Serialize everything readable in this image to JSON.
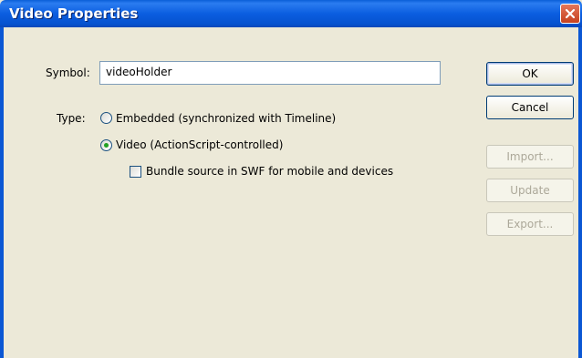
{
  "window": {
    "title": "Video Properties"
  },
  "symbol": {
    "label": "Symbol:",
    "value": "videoHolder"
  },
  "type": {
    "label": "Type:",
    "options": [
      {
        "label": "Embedded (synchronized with Timeline)",
        "selected": false
      },
      {
        "label": "Video (ActionScript-controlled)",
        "selected": true
      }
    ]
  },
  "bundle": {
    "label": "Bundle source in SWF for mobile and devices",
    "checked": false
  },
  "buttons": {
    "ok": "OK",
    "cancel": "Cancel",
    "import": "Import...",
    "update": "Update",
    "export": "Export..."
  },
  "icons": {
    "close": "close-icon"
  }
}
